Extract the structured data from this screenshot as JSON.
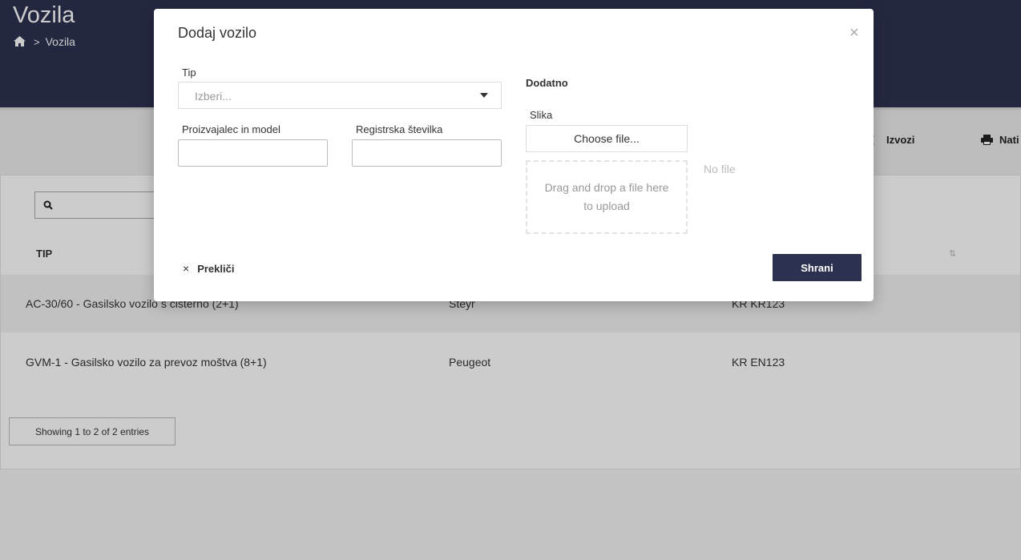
{
  "page": {
    "title": "Vozila",
    "breadcrumb": {
      "current": "Vozila",
      "separator": ">"
    }
  },
  "toolbar": {
    "export_label": "Izvozi",
    "print_label": "Nati"
  },
  "table": {
    "columns": [
      "TIP"
    ],
    "rows": [
      {
        "type": "AC-30/60 - Gasilsko vozilo s cisterno (2+1)",
        "make": "Steyr",
        "plate": "KR KR123"
      },
      {
        "type": "GVM-1 - Gasilsko vozilo za prevoz moštva (8+1)",
        "make": "Peugeot",
        "plate": "KR EN123"
      }
    ],
    "showing": "Showing 1 to 2 of 2 entries"
  },
  "modal": {
    "title": "Dodaj vozilo",
    "close": "×",
    "type_label": "Tip",
    "type_placeholder": "Izberi...",
    "make_label": "Proizvajalec in model",
    "make_value": "",
    "plate_label": "Registrska številka",
    "plate_value": "",
    "section_title": "Dodatno",
    "image_label": "Slika",
    "choose_file": "Choose file...",
    "dropzone_text": "Drag and drop a file here to upload",
    "no_file": "No file",
    "cancel_icon": "×",
    "cancel_label": "Prekliči",
    "save_label": "Shrani"
  },
  "colors": {
    "header": "#2d3150",
    "primary_button": "#2d3150"
  }
}
